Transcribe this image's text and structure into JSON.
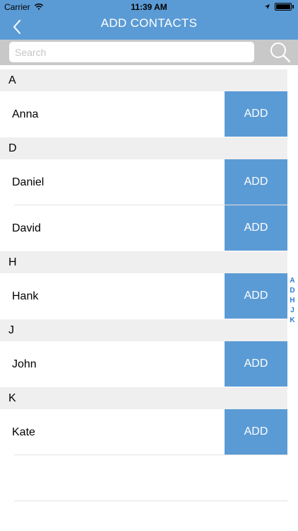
{
  "status_bar": {
    "carrier": "Carrier",
    "time": "11:39 AM"
  },
  "nav": {
    "title": "ADD CONTACTS",
    "back_icon": "chevron-left-icon"
  },
  "search": {
    "placeholder": "Search",
    "value": "",
    "icon": "search-icon"
  },
  "sections": [
    {
      "letter": "A",
      "contacts": [
        {
          "name": "Anna",
          "button": "ADD"
        }
      ]
    },
    {
      "letter": "D",
      "contacts": [
        {
          "name": "Daniel",
          "button": "ADD"
        },
        {
          "name": "David",
          "button": "ADD"
        }
      ]
    },
    {
      "letter": "H",
      "contacts": [
        {
          "name": "Hank",
          "button": "ADD"
        }
      ]
    },
    {
      "letter": "J",
      "contacts": [
        {
          "name": "John",
          "button": "ADD"
        }
      ]
    },
    {
      "letter": "K",
      "contacts": [
        {
          "name": "Kate",
          "button": "ADD"
        }
      ]
    }
  ],
  "index_letters": [
    "A",
    "D",
    "H",
    "J",
    "K"
  ],
  "colors": {
    "accent": "#5b9bd5",
    "section_bg": "#efefef",
    "index_text": "#2f7bd0"
  }
}
